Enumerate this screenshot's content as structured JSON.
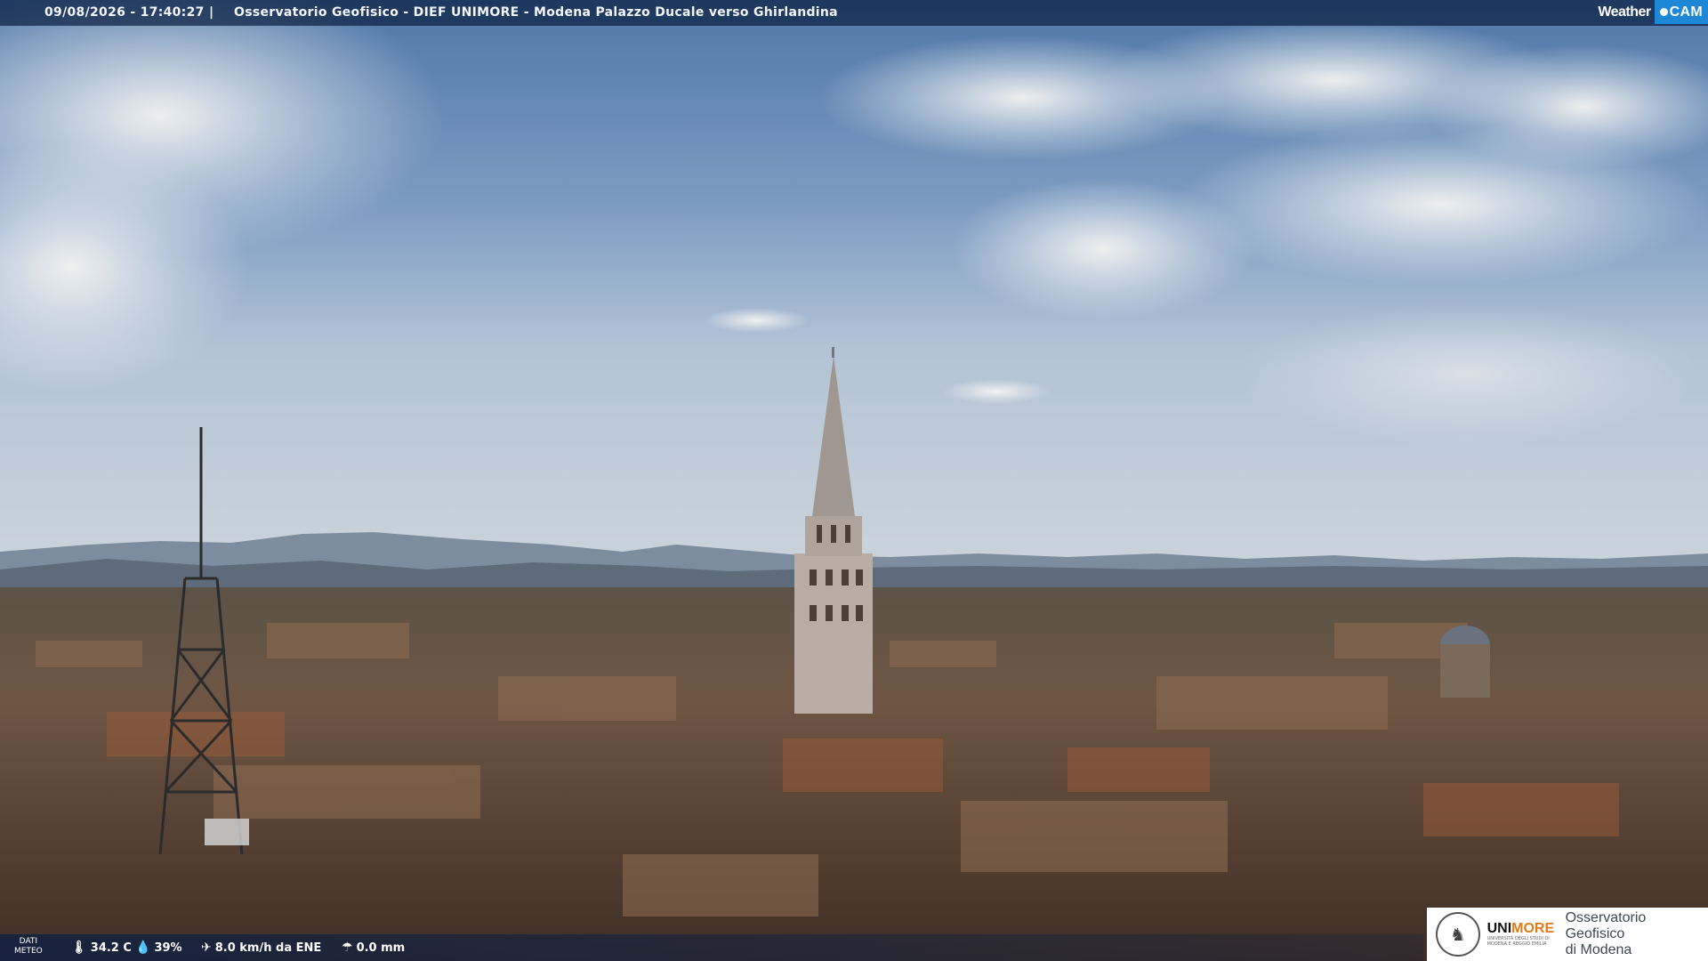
{
  "header": {
    "timestamp": "09/08/2026 - 17:40:27",
    "separator": "|",
    "camera_title": "Osservatorio Geofisico - DIEF UNIMORE - Modena Palazzo Ducale verso Ghirlandina",
    "brand_weather": "Weather",
    "brand_cam": "CAM"
  },
  "weather": {
    "label_line1": "DATI",
    "label_line2": "METEO",
    "temperature": "34.2 C",
    "humidity": "39%",
    "wind": "8.0 km/h da ENE",
    "rain": "0.0 mm",
    "icons": {
      "temperature": "thermometer-icon",
      "humidity": "droplet-icon",
      "wind": "wind-icon",
      "rain": "rain-gauge-icon"
    }
  },
  "logo": {
    "uni_name_part1": "UNI",
    "uni_name_part2": "MORE",
    "uni_sub": "UNIVERSITÀ DEGLI STUDI DI MODENA E REGGIO EMILIA",
    "observatory_line1": "Osservatorio Geofisico",
    "observatory_line2": "di Modena"
  },
  "colors": {
    "bar": "#0c2042",
    "accent_cam": "#1e88d6",
    "unimore_orange": "#e07b1a"
  }
}
